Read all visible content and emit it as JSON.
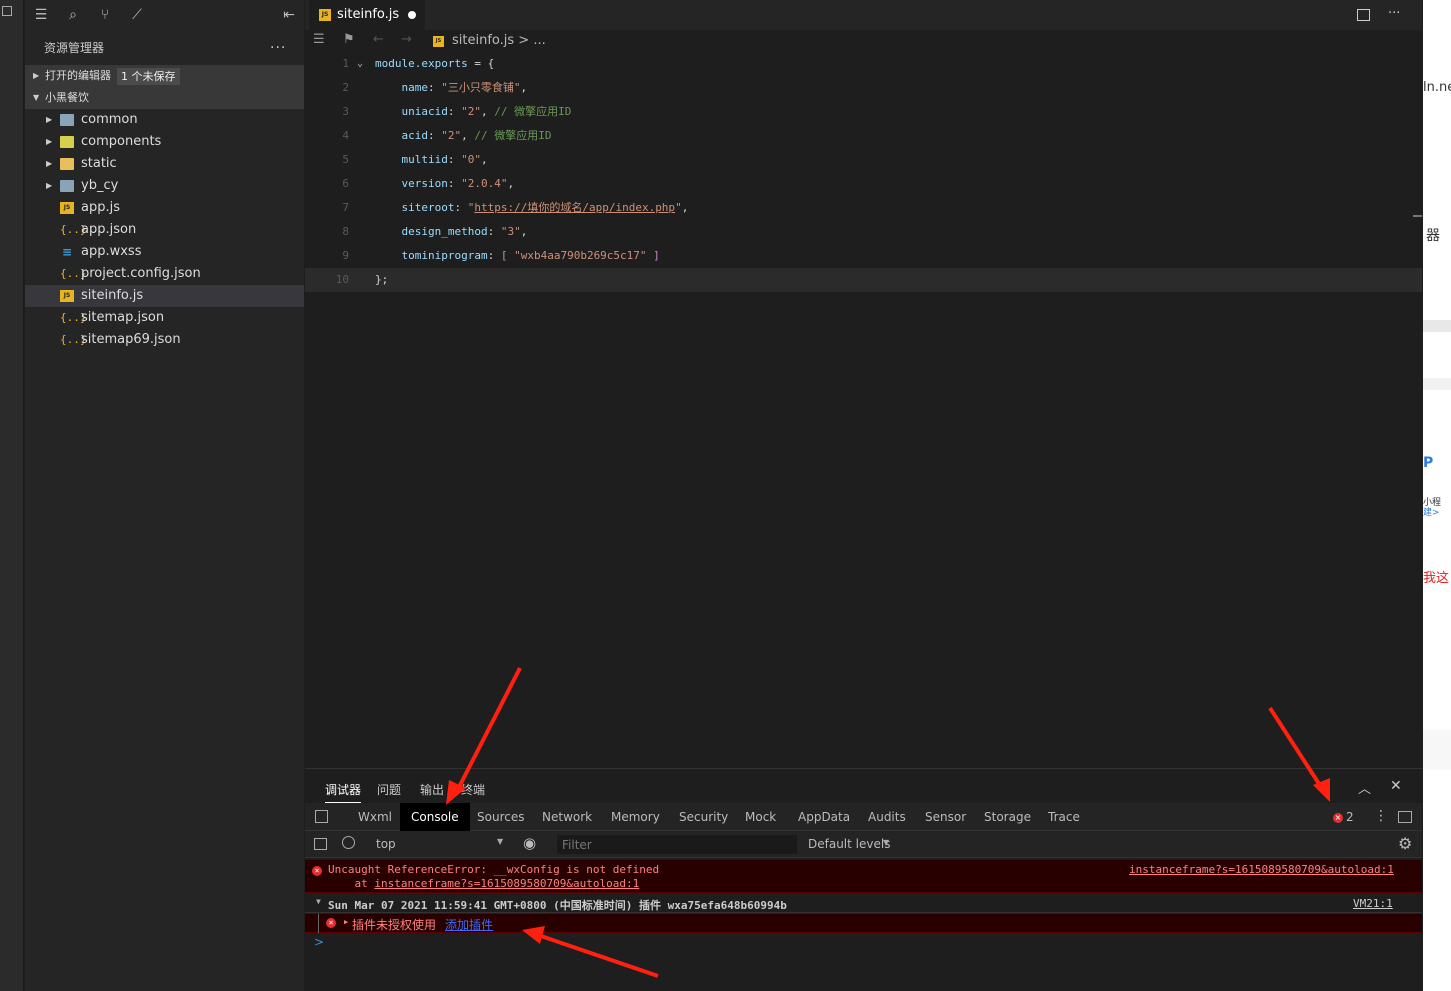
{
  "sidebar": {
    "title": "资源管理器",
    "more": "...",
    "open_editors": {
      "label": "打开的编辑器",
      "badge": "1 个未保存"
    },
    "project": {
      "label": "小黑餐饮"
    },
    "items": [
      {
        "name": "common",
        "kind": "folder"
      },
      {
        "name": "components",
        "kind": "folder"
      },
      {
        "name": "static",
        "kind": "folder"
      },
      {
        "name": "yb_cy",
        "kind": "folder"
      },
      {
        "name": "app.js",
        "kind": "js"
      },
      {
        "name": "app.json",
        "kind": "json"
      },
      {
        "name": "app.wxss",
        "kind": "wxss"
      },
      {
        "name": "project.config.json",
        "kind": "json"
      },
      {
        "name": "siteinfo.js",
        "kind": "js"
      },
      {
        "name": "sitemap.json",
        "kind": "json"
      },
      {
        "name": "sitemap69.json",
        "kind": "json"
      }
    ]
  },
  "editor": {
    "tab": {
      "name": "siteinfo.js",
      "icon": "JS"
    },
    "breadcrumb": {
      "file": "siteinfo.js",
      "rest": "> ..."
    },
    "code": {
      "l1_obj": "module.exports",
      "l1_rest": " = {",
      "l2_key": "    name",
      "l2_val": "\"三小只零食铺\"",
      "l3_key": "    uniacid",
      "l3_val": "\"2\"",
      "l3_cmt": "// 微擎应用ID",
      "l4_key": "    acid",
      "l4_val": "\"2\"",
      "l4_cmt": "// 微擎应用ID",
      "l5_key": "    multiid",
      "l5_val": "\"0\"",
      "l6_key": "    version",
      "l6_val": "\"2.0.4\"",
      "l7_key": "    siteroot",
      "l7_q": "\"",
      "l7_val": "https://填你的域名/app/index.php",
      "l8_key": "    design_method",
      "l8_val": "\"3\"",
      "l9_key": "    tominiprogram",
      "l9_val": "\"wxb4aa790b269c5c17\"",
      "l10": "};"
    },
    "line_numbers": [
      "1",
      "2",
      "3",
      "4",
      "5",
      "6",
      "7",
      "8",
      "9",
      "10"
    ]
  },
  "panel": {
    "tabs": [
      "调试器",
      "问题",
      "输出",
      "终端"
    ],
    "devtools_tabs": [
      "Wxml",
      "Console",
      "Sources",
      "Network",
      "Memory",
      "Security",
      "Mock",
      "AppData",
      "Audits",
      "Sensor",
      "Storage",
      "Trace"
    ],
    "error_count": "2",
    "context": "top",
    "filter_placeholder": "Filter",
    "levels": "Default levels",
    "console": {
      "err1_msg": "Uncaught ReferenceError: __wxConfig is not defined",
      "err1_at": "    at ",
      "err1_link": "instanceframe?s=1615089580709&autoload:1",
      "err1_src": "instanceframe?s=1615089580709&autoload:1",
      "group_title": "Sun Mar 07 2021 11:59:41 GMT+0800 (中国标准时间) 插件 wxa75efa648b60994b",
      "group_src": "VM21:1",
      "err2_msg": "插件未授权使用",
      "err2_link": "添加插件",
      "prompt": ">"
    }
  },
  "right_edge": {
    "t1": "ln.ne",
    "t2": "器",
    "t3": "小程",
    "t4": "建>",
    "t5": "我这"
  },
  "colors": {
    "accent_error": "#e03030",
    "arrow": "#ff2010"
  }
}
